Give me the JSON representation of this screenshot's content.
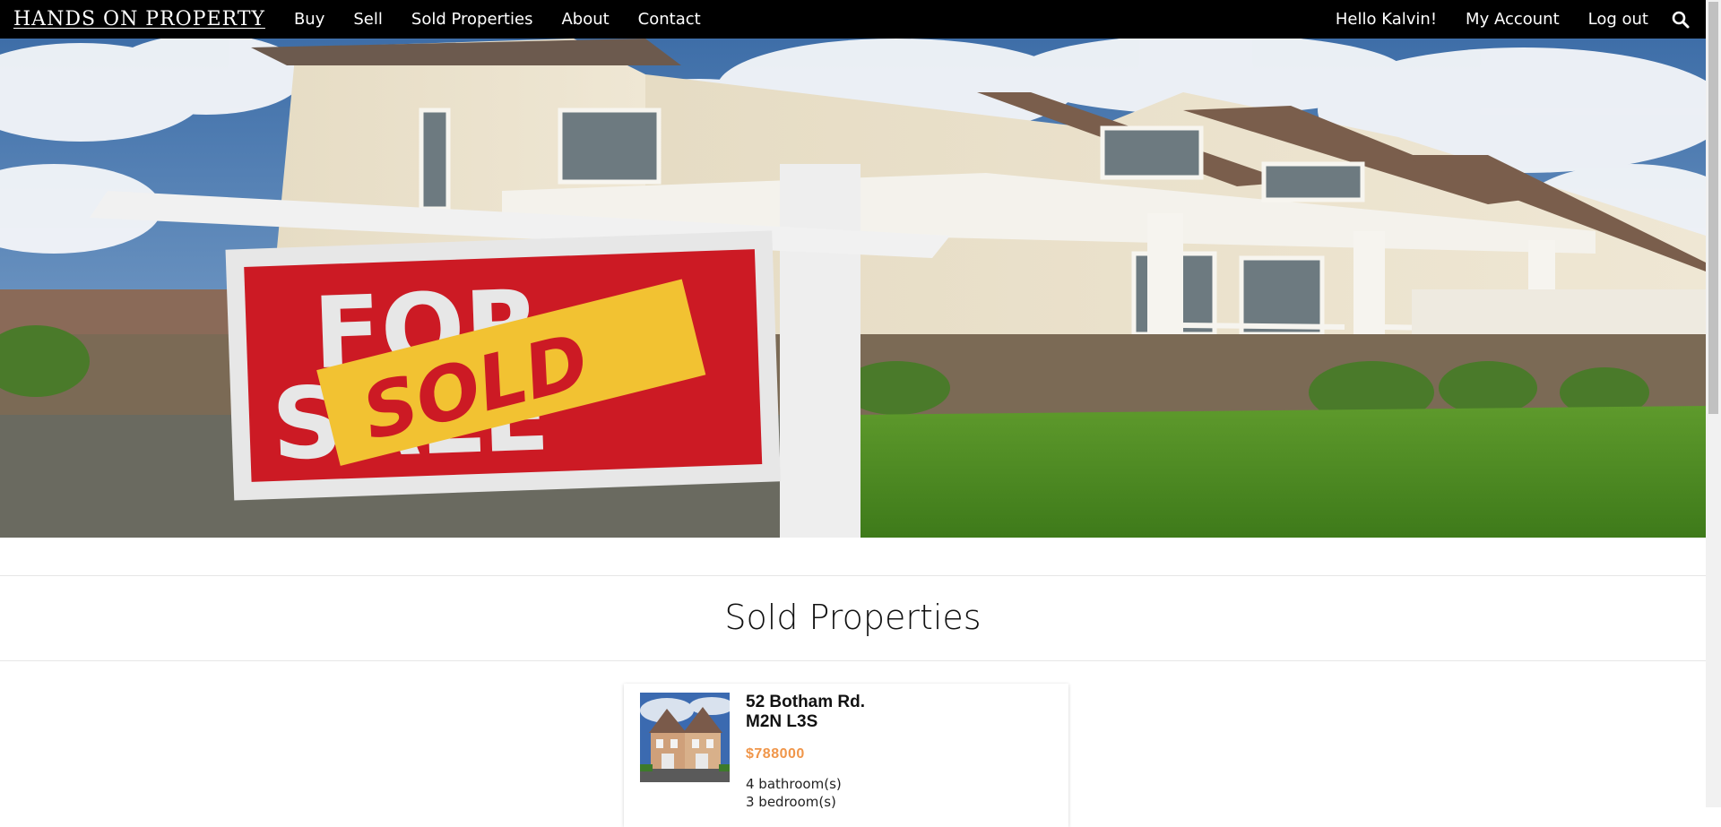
{
  "navbar": {
    "brand": "HANDS ON PROPERTY",
    "left_links": [
      "Buy",
      "Sell",
      "Sold Properties",
      "About",
      "Contact"
    ],
    "greeting": "Hello Kalvin!",
    "account": "My Account",
    "logout": "Log out",
    "search_icon": "search-icon"
  },
  "hero": {
    "sign_text_top": "FOR",
    "sign_text_bottom": "SALE",
    "sign_overlay": "SOLD"
  },
  "section": {
    "title": "Sold Properties"
  },
  "listings": [
    {
      "address_line1": "52 Botham Rd.",
      "address_line2": "M2N L3S",
      "price": "$788000",
      "bathrooms": "4 bathroom(s)",
      "bedrooms": "3 bedroom(s)"
    }
  ],
  "colors": {
    "navbar_bg": "#000000",
    "price": "#f0964a",
    "sign_red": "#cc1a24",
    "sold_yellow": "#f2c232"
  }
}
